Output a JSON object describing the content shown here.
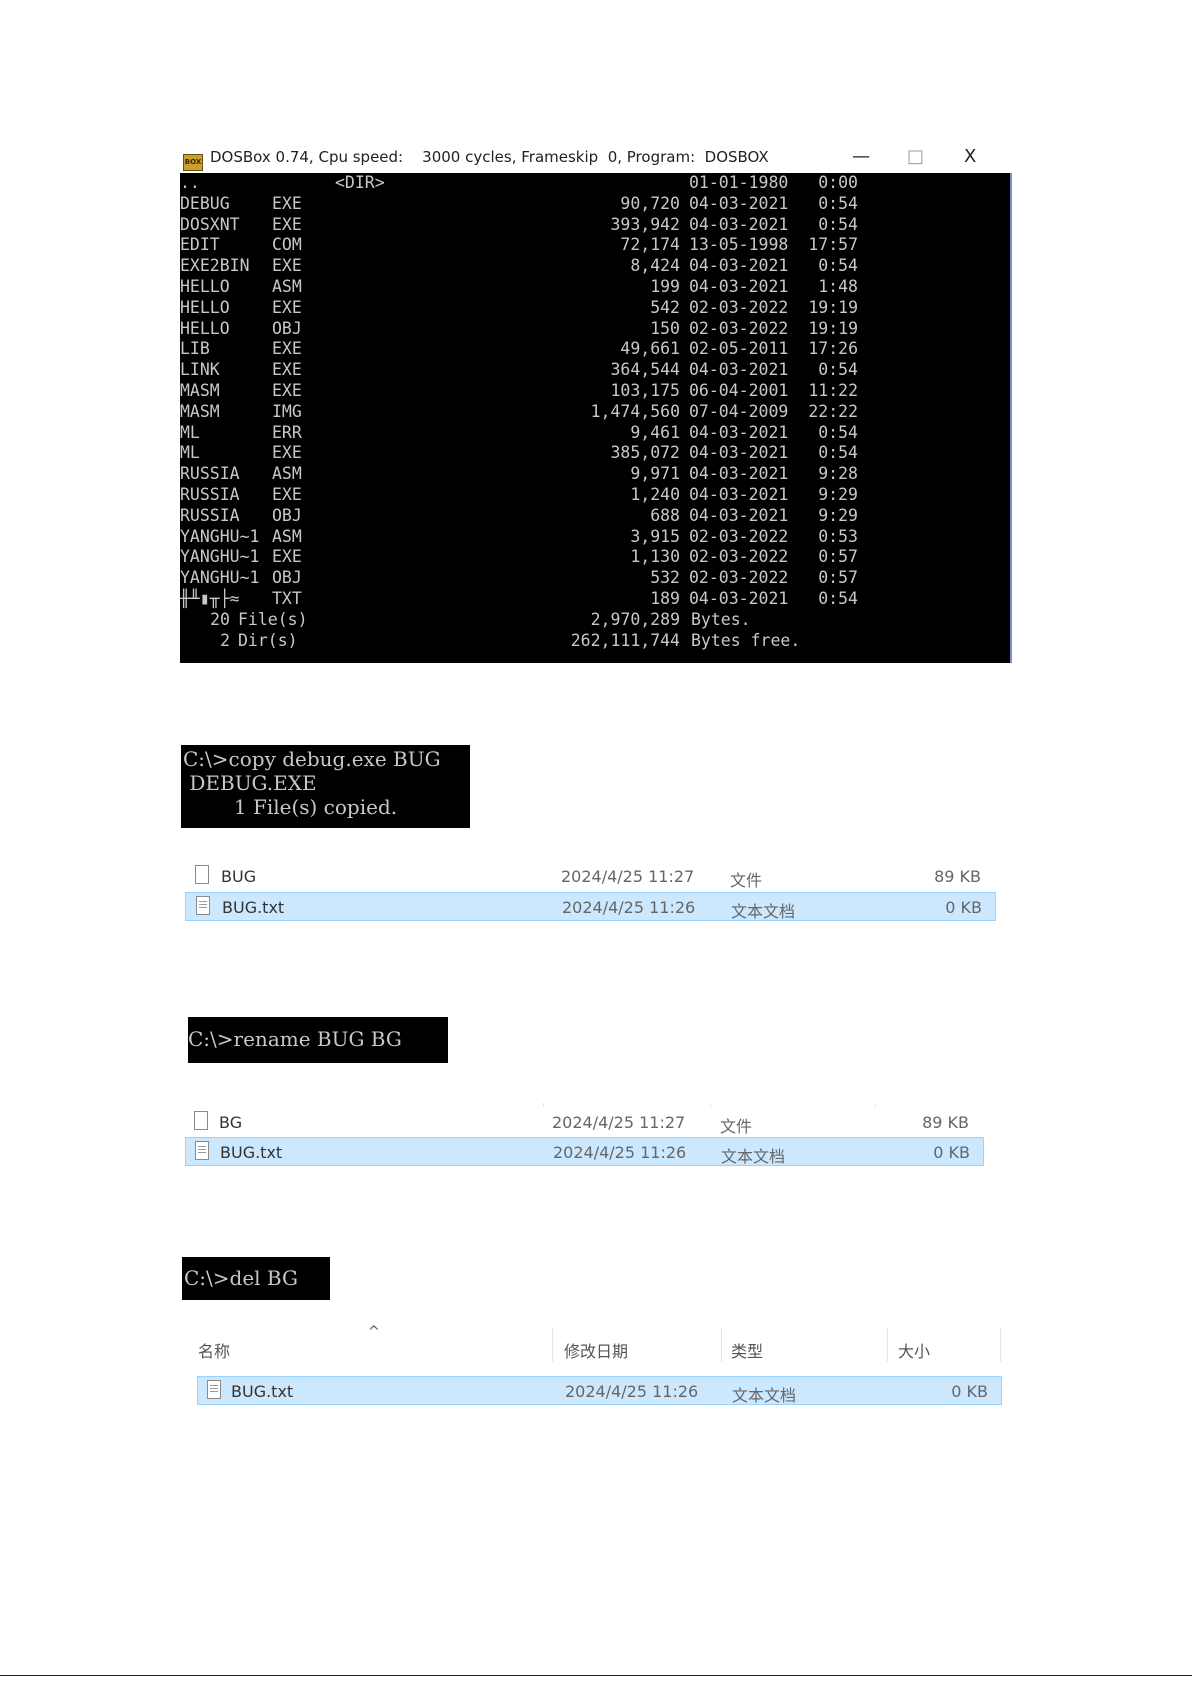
{
  "dosbox": {
    "title": "DOSBox 0.74, Cpu speed:    3000 cycles, Frameskip  0, Program:  DOSBOX",
    "icon_label": "BOX",
    "minimize_glyph": "—",
    "maximize_glyph": "□",
    "close_glyph": "X",
    "parent_entry": {
      "name": "..",
      "dir": "<DIR>",
      "date": "01-01-1980",
      "time": "0:00"
    },
    "listing": [
      {
        "name": "DEBUG",
        "ext": "EXE",
        "size": "90,720",
        "date": "04-03-2021",
        "time": "0:54"
      },
      {
        "name": "DOSXNT",
        "ext": "EXE",
        "size": "393,942",
        "date": "04-03-2021",
        "time": "0:54"
      },
      {
        "name": "EDIT",
        "ext": "COM",
        "size": "72,174",
        "date": "13-05-1998",
        "time": "17:57"
      },
      {
        "name": "EXE2BIN",
        "ext": "EXE",
        "size": "8,424",
        "date": "04-03-2021",
        "time": "0:54"
      },
      {
        "name": "HELLO",
        "ext": "ASM",
        "size": "199",
        "date": "04-03-2021",
        "time": "1:48"
      },
      {
        "name": "HELLO",
        "ext": "EXE",
        "size": "542",
        "date": "02-03-2022",
        "time": "19:19"
      },
      {
        "name": "HELLO",
        "ext": "OBJ",
        "size": "150",
        "date": "02-03-2022",
        "time": "19:19"
      },
      {
        "name": "LIB",
        "ext": "EXE",
        "size": "49,661",
        "date": "02-05-2011",
        "time": "17:26"
      },
      {
        "name": "LINK",
        "ext": "EXE",
        "size": "364,544",
        "date": "04-03-2021",
        "time": "0:54"
      },
      {
        "name": "MASM",
        "ext": "EXE",
        "size": "103,175",
        "date": "06-04-2001",
        "time": "11:22"
      },
      {
        "name": "MASM",
        "ext": "IMG",
        "size": "1,474,560",
        "date": "07-04-2009",
        "time": "22:22"
      },
      {
        "name": "ML",
        "ext": "ERR",
        "size": "9,461",
        "date": "04-03-2021",
        "time": "0:54"
      },
      {
        "name": "ML",
        "ext": "EXE",
        "size": "385,072",
        "date": "04-03-2021",
        "time": "0:54"
      },
      {
        "name": "RUSSIA",
        "ext": "ASM",
        "size": "9,971",
        "date": "04-03-2021",
        "time": "9:28"
      },
      {
        "name": "RUSSIA",
        "ext": "EXE",
        "size": "1,240",
        "date": "04-03-2021",
        "time": "9:29"
      },
      {
        "name": "RUSSIA",
        "ext": "OBJ",
        "size": "688",
        "date": "04-03-2021",
        "time": "9:29"
      },
      {
        "name": "YANGHU~1",
        "ext": "ASM",
        "size": "3,915",
        "date": "02-03-2022",
        "time": "0:53"
      },
      {
        "name": "YANGHU~1",
        "ext": "EXE",
        "size": "1,130",
        "date": "02-03-2022",
        "time": "0:57"
      },
      {
        "name": "YANGHU~1",
        "ext": "OBJ",
        "size": "532",
        "date": "02-03-2022",
        "time": "0:57"
      },
      {
        "name": "╫╨▮╥├≈",
        "ext": "TXT",
        "size": "189",
        "date": "04-03-2021",
        "time": "0:54"
      }
    ],
    "summary": {
      "files_count": "20",
      "files_label": "File(s)",
      "files_bytes": "2,970,289",
      "files_unit": "Bytes.",
      "dirs_count": "2",
      "dirs_label": "Dir(s)",
      "dirs_bytes": "262,111,744",
      "dirs_unit": "Bytes free."
    }
  },
  "console_copy": {
    "line1": "C:\\>copy debug.exe BUG",
    "line2": " DEBUG.EXE",
    "line3": "        1 File(s) copied."
  },
  "explorer1": {
    "rows": [
      {
        "name": "BUG",
        "date": "2024/4/25 11:27",
        "type": "文件",
        "size": "89 KB"
      },
      {
        "name": "BUG.txt",
        "date": "2024/4/25 11:26",
        "type": "文本文档",
        "size": "0 KB"
      }
    ]
  },
  "console_rename": {
    "line1": "C:\\>rename BUG BG"
  },
  "explorer2": {
    "rows": [
      {
        "name": "BG",
        "date": "2024/4/25 11:27",
        "type": "文件",
        "size": "89 KB"
      },
      {
        "name": "BUG.txt",
        "date": "2024/4/25 11:26",
        "type": "文本文档",
        "size": "0 KB"
      }
    ]
  },
  "console_del": {
    "line1": "C:\\>del BG"
  },
  "explorer3": {
    "headers": {
      "name": "名称",
      "date": "修改日期",
      "type": "类型",
      "size": "大小"
    },
    "sort_glyph": "^",
    "rows": [
      {
        "name": "BUG.txt",
        "date": "2024/4/25 11:26",
        "type": "文本文档",
        "size": "0 KB"
      }
    ]
  }
}
